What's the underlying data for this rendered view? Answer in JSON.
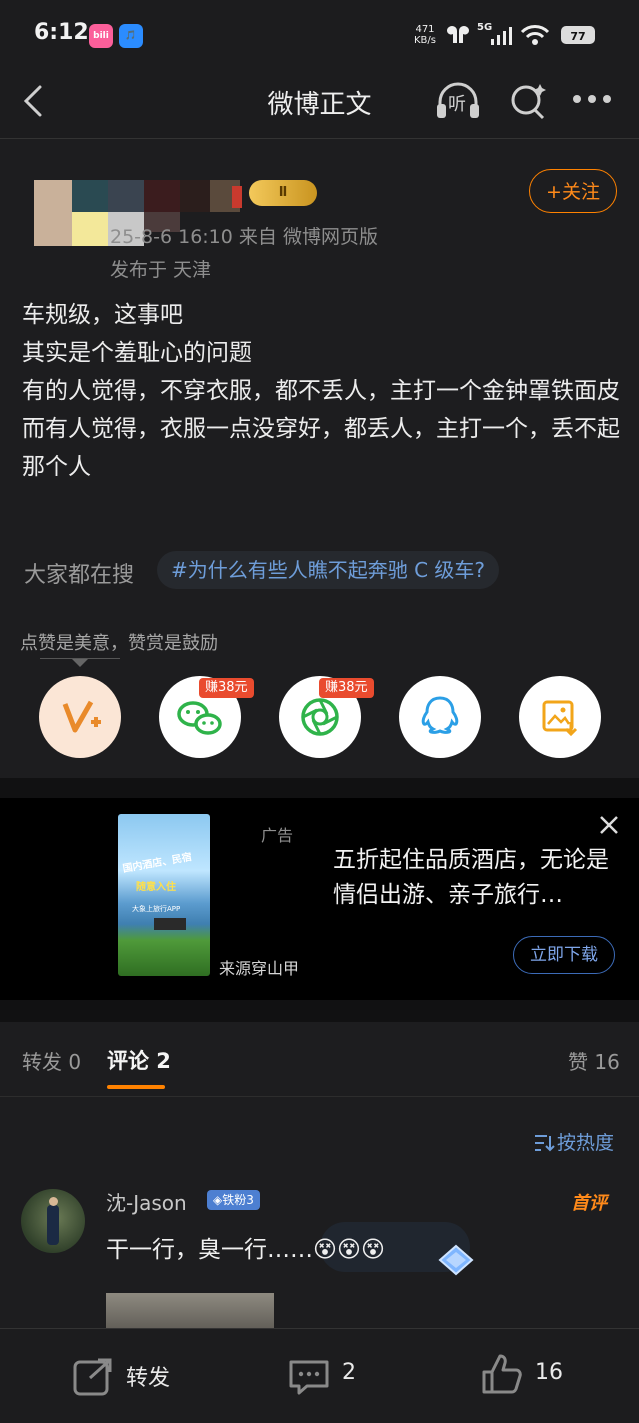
{
  "status_bar": {
    "time": "6:12",
    "app_icon_1": "bili",
    "app_icon_2": "🎵",
    "net_speed_value": "471",
    "net_speed_unit": "KB/s",
    "network": "5G",
    "battery": "77"
  },
  "nav": {
    "title": "微博正文",
    "back_icon": "chevron-left-icon",
    "listen_label": "听",
    "search_icon": "search-spark-icon",
    "more_icon": "more-dots-icon"
  },
  "post": {
    "vip_level": "Ⅱ",
    "follow_label": "+关注",
    "meta": "25-8-6 16:10  来自 微博网页版",
    "location": "发布于 天津",
    "lines": [
      "车规级，这事吧",
      "其实是个羞耻心的问题",
      "有的人觉得，不穿衣服，都不丢人，主打一个金钟罩铁面皮",
      "而有人觉得，衣服一点没穿好，都丢人，主打一个，丢不起那个人"
    ],
    "search_label": "大家都在搜",
    "search_tag": "#为什么有些人瞧不起奔驰 C 级车?",
    "like_tip": "点赞是美意，赞赏是鼓励",
    "share": [
      {
        "icon": "reward-icon",
        "badge": ""
      },
      {
        "icon": "wechat-icon",
        "badge": "赚38元"
      },
      {
        "icon": "moments-icon",
        "badge": "赚38元"
      },
      {
        "icon": "qq-icon",
        "badge": ""
      },
      {
        "icon": "save-image-icon",
        "badge": ""
      }
    ]
  },
  "ad": {
    "tag": "广告",
    "source": "来源穿山甲",
    "text": "五折起住品质酒店，无论是情侣出游、亲子旅行…",
    "download_label": "立即下载",
    "image_caption_1": "国内酒店、民宿",
    "image_caption_2": "随意入住",
    "image_caption_3": "大象上旅行APP"
  },
  "tabs": {
    "repost": "转发 0",
    "comment": "评论 2",
    "like": "赞 16"
  },
  "sort_label": "按热度",
  "comment": {
    "name": "沈-Jason",
    "fan_badge": "◈铁粉3",
    "first_badge": "首评",
    "text": "干一行，臭一行……😵😵😵"
  },
  "bottom": {
    "repost_label": "转发",
    "comment_count": "2",
    "like_count": "16"
  }
}
